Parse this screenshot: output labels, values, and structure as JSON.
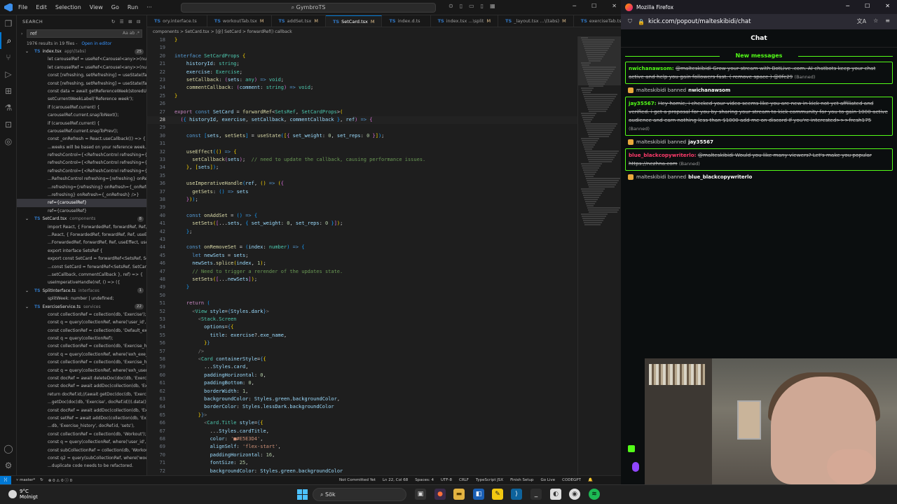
{
  "vscode": {
    "menu": [
      "File",
      "Edit",
      "Selection",
      "View",
      "Go",
      "Run"
    ],
    "nav": [
      "←",
      "→"
    ],
    "command_center": "GymbroTS",
    "sidebar": {
      "title": "SEARCH",
      "query": "ref",
      "summary": "1976 results in 19 files -",
      "open_in_editor": "Open in editor",
      "results": [
        {
          "type": "file",
          "name": "index.tsx",
          "path": "app\\(tabs)",
          "count": "25"
        },
        {
          "type": "line",
          "text": "let carouselRef = useRef<Carousel<any>>(null);"
        },
        {
          "type": "line",
          "text": "let carouselRef = useRef<Carousel<any>>(null);"
        },
        {
          "type": "line",
          "text": "const [refreshing, setRefreshing] = useState(false);"
        },
        {
          "type": "line",
          "text": "const [refreshing, setRefreshing] = useState(false);"
        },
        {
          "type": "line",
          "text": "const data = await getReferenceWeek(storedUser.id);"
        },
        {
          "type": "line",
          "text": "setCurrentWeekLabel('Reference week');"
        },
        {
          "type": "line",
          "text": "if (carouselRef.current) {"
        },
        {
          "type": "line",
          "text": "carouselRef.current.snapToNext();"
        },
        {
          "type": "line",
          "text": "if (carouselRef.current) {"
        },
        {
          "type": "line",
          "text": "carouselRef.current.snapToPrev();"
        },
        {
          "type": "line",
          "text": "const _onRefresh = React.useCallback(() => {"
        },
        {
          "type": "line",
          "text": "...weeks will be based on your reference week. Add th..."
        },
        {
          "type": "line",
          "text": "refreshControl={<RefreshControl refreshing={refreshi..."
        },
        {
          "type": "line",
          "text": "refreshControl={<RefreshControl refreshing={refreshi..."
        },
        {
          "type": "line",
          "text": "refreshControl={<RefreshControl refreshing={refreshi..."
        },
        {
          "type": "line",
          "text": "...RefreshControl refreshing={refreshing} onRefresh={..."
        },
        {
          "type": "line",
          "text": "...refreshing={refreshing} onRefresh={_onRefresh} />}"
        },
        {
          "type": "line",
          "text": "...refreshing} onRefresh={_onRefresh} />}"
        },
        {
          "type": "line",
          "text": "ref={carouselRef}",
          "selected": true
        },
        {
          "type": "line",
          "text": "ref={carouselRef}"
        },
        {
          "type": "file",
          "name": "SetCard.tsx",
          "path": "components",
          "count": "8"
        },
        {
          "type": "line",
          "text": "import React, { ForwardedRef, forwardRef, Ref, useEff..."
        },
        {
          "type": "line",
          "text": "...React, { ForwardedRef, forwardRef, Ref, useEffect, us..."
        },
        {
          "type": "line",
          "text": "...ForwardedRef, forwardRef, Ref, useEffect, useImpera..."
        },
        {
          "type": "line",
          "text": "export interface SetsRef {"
        },
        {
          "type": "line",
          "text": "export const SetCard = forwardRef<SetsRef, SetCard..."
        },
        {
          "type": "line",
          "text": "...const SetCard = forwardRef<SetsRef, SetCardProps>(("
        },
        {
          "type": "line",
          "text": "...setCallback, commentCallback }, ref) => {"
        },
        {
          "type": "line",
          "text": "useImperativeHandle(ref, () => ({"
        },
        {
          "type": "file",
          "name": "SplitInterface.ts",
          "path": "interfaces",
          "count": "1"
        },
        {
          "type": "line",
          "text": "splitWeek: number | undefined;"
        },
        {
          "type": "file",
          "name": "ExerciseService.ts",
          "path": "services",
          "count": "22"
        },
        {
          "type": "line",
          "text": "const collectionRef = collection(db, 'Exercise');"
        },
        {
          "type": "line",
          "text": "const q = query(collectionRef, where('user_id', '=..."
        },
        {
          "type": "line",
          "text": "const collectionRef = collection(db, 'Default_exercises');"
        },
        {
          "type": "line",
          "text": "const q = query(collectionRef);"
        },
        {
          "type": "line",
          "text": "const collectionRef = collection(db, 'Exercise_history');"
        },
        {
          "type": "line",
          "text": "const q = query(collectionRef, where('exh_exe_id', '=..."
        },
        {
          "type": "line",
          "text": "const collectionRef = collection(db, 'Exercise_history');"
        },
        {
          "type": "line",
          "text": "const q = query(collectionRef, where('exh_user_id', '=..."
        },
        {
          "type": "line",
          "text": "const docRef = await deleteDoc(doc(db, 'Exercise', e..."
        },
        {
          "type": "line",
          "text": "const docRef = await addDoc(collection(db, 'Exercis..."
        },
        {
          "type": "line",
          "text": "return docRef.id;//(await getDoc(doc(db, 'Exercise', d..."
        },
        {
          "type": "line",
          "text": "...getDoc(doc(db, 'Exercise', docRef.id))).data(); TODO..."
        },
        {
          "type": "line",
          "text": "const docRef = await addDoc(collection(db, 'Exercis..."
        },
        {
          "type": "line",
          "text": "const setRef = await addDoc(collection(db, 'Exercise..."
        },
        {
          "type": "line",
          "text": "...db, 'Exercise_history', docRef.id, 'sets'),"
        },
        {
          "type": "line",
          "text": "const collectionRef = collection(db, 'Workout');"
        },
        {
          "type": "line",
          "text": "const q = query(collectionRef, where('user_id', '=..."
        },
        {
          "type": "line",
          "text": "const subCollectionRef = collection(db, 'Workout', wo..."
        },
        {
          "type": "line",
          "text": "const q2 = query(subCollectionRef, where('woe_exer..."
        },
        {
          "type": "line",
          "text": "...duplicate code needs to be refactored."
        }
      ]
    },
    "tabs": [
      {
        "label": "ory.interface.ts",
        "modified": ""
      },
      {
        "label": "workoutTab.tsx",
        "modified": "M"
      },
      {
        "label": "addSet.tsx",
        "modified": "M"
      },
      {
        "label": "SetCard.tsx",
        "modified": "M",
        "active": true
      },
      {
        "label": "index.d.ts",
        "modified": ""
      },
      {
        "label": "index.tsx ...\\split",
        "modified": "M"
      },
      {
        "label": "_layout.tsx ...\\(tabs)",
        "modified": "M"
      },
      {
        "label": "exerciseTab.tsx",
        "modified": "M"
      }
    ],
    "breadcrumb": "components > SetCard.tsx > [@] SetCard > forwardRef() callback",
    "status": {
      "branch": "master*",
      "sync": "↻",
      "problems": "⊗ 0 ⚠ 0 ⓘ 0",
      "git": "Not Committed Yet",
      "position": "Ln 22, Col 68",
      "spaces": "Spaces: 4",
      "encoding": "UTF-8",
      "eol": "CRLF",
      "lang": "TypeScript JSX",
      "setup": "Finish Setup",
      "golive": "Go Live",
      "codegpt": "CODEGPT"
    }
  },
  "firefox": {
    "title": "Mozilla Firefox",
    "url": "kick.com/popout/malteskibidi/chat",
    "chat_header": "Chat",
    "new_messages": "New messages",
    "items": [
      {
        "kind": "msg",
        "user": "nwichanawsom:",
        "user_color": "#53fc18",
        "text": "@malteskibidi Grow your stream with BotLive .com. AI chatbots keep your chat active and help you gain followers fast. ( remove space ) @0fc29",
        "banned": "(Banned)"
      },
      {
        "kind": "ban",
        "mod": "malteskibidi",
        "action": "banned",
        "target": "nwichanawsom"
      },
      {
        "kind": "msg",
        "user": "jay35567:",
        "user_color": "#53fc18",
        "text": "Hey homie, i checked your video seems like you are new in kick not yet affiliated and verified. i get a proposal for you by sharing your stream to kick community for you to gain 1000 active audience and earn nothing less than $1000 add me on discord If you're interested>>>fresh175",
        "banned": "(Banned)"
      },
      {
        "kind": "ban",
        "mod": "malteskibidi",
        "action": "banned",
        "target": "jay35567"
      },
      {
        "kind": "msg",
        "user": "blue_blackcopywriterlo:",
        "user_color": "#ff3b6b",
        "text": "@malteskibidi Would you like many viewers? Let's make you popular https://nezhna.com",
        "banned": "(Banned)"
      },
      {
        "kind": "ban",
        "mod": "malteskibidi",
        "action": "banned",
        "target": "blue_blackcopywriterlo"
      }
    ]
  },
  "taskbar": {
    "temp": "9°C",
    "weather": "Molnigt",
    "search": "Sök"
  }
}
